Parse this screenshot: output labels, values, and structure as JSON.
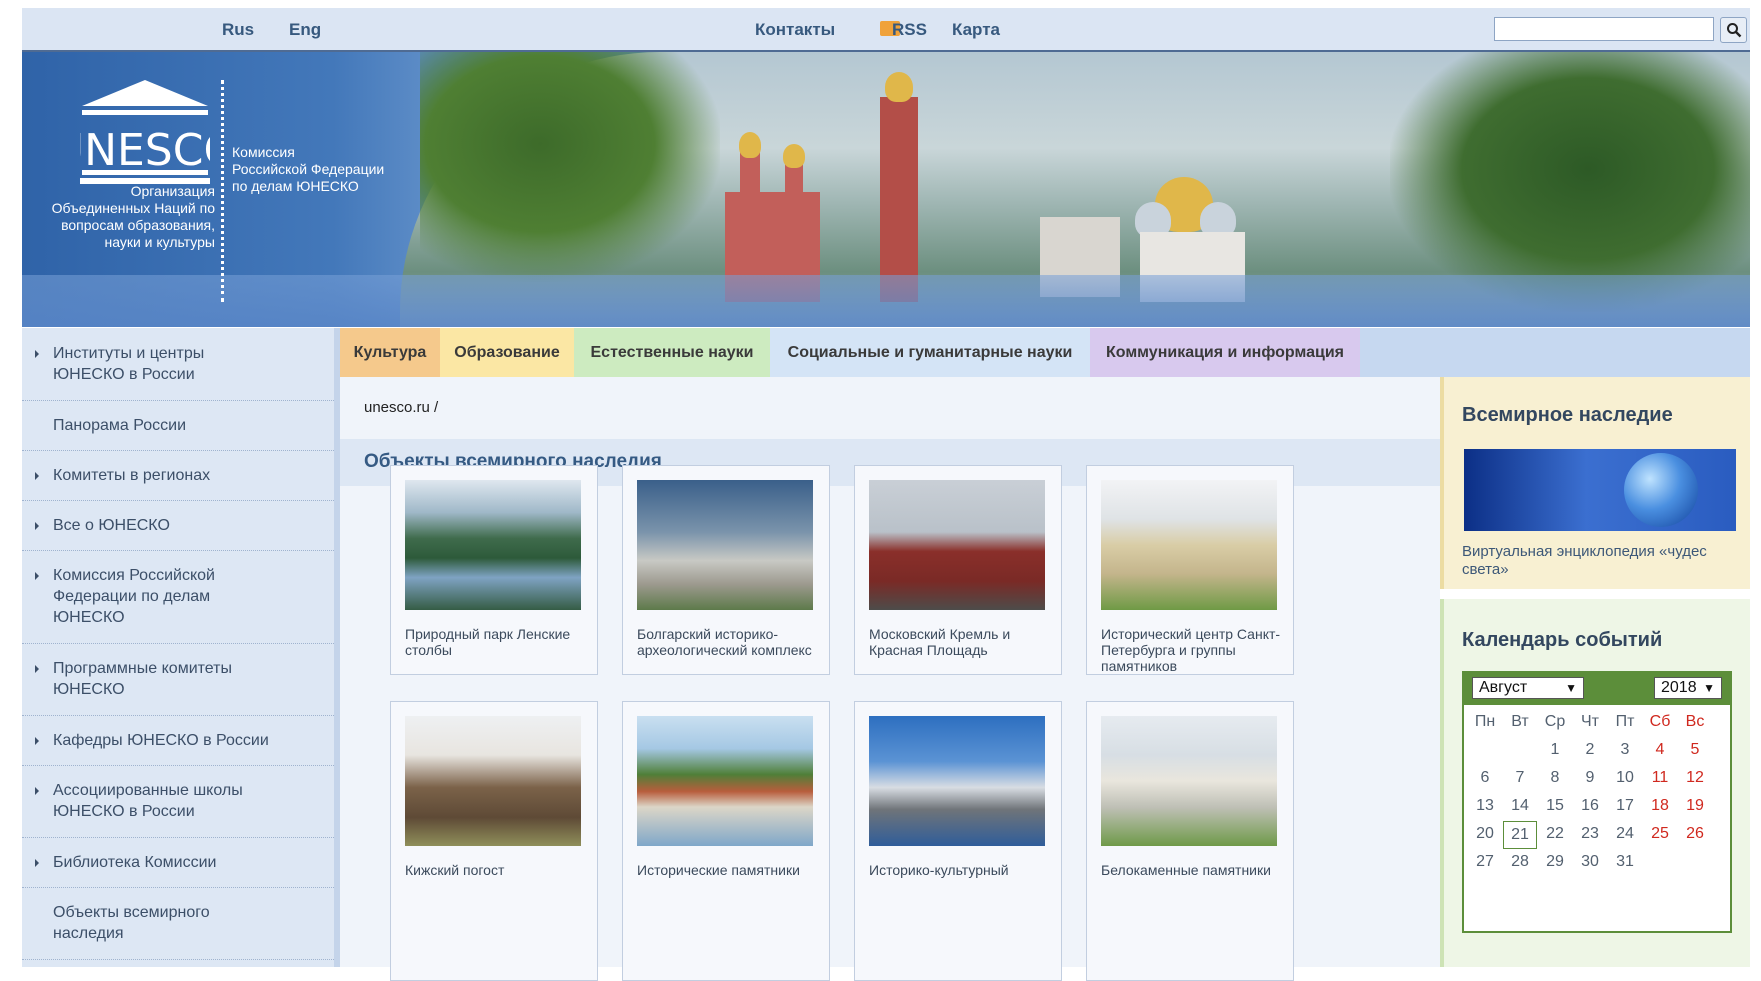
{
  "topbar": {
    "lang": [
      "Rus",
      "Eng"
    ],
    "contacts": "Контакты",
    "rss": "RSS",
    "map": "Карта",
    "search_value": ""
  },
  "banner": {
    "logo_text": "UNESCO",
    "commission": [
      "Комиссия",
      "Российской Федерации",
      "по делам ЮНЕСКО"
    ],
    "org": [
      "Организация",
      "Объединенных Наций по",
      "вопросам образования,",
      "науки и культуры"
    ]
  },
  "sidebar": {
    "items": [
      {
        "label": [
          "Институты и центры",
          "ЮНЕСКО в России"
        ],
        "bullet": true
      },
      {
        "label": [
          "Панорама России"
        ],
        "bullet": false
      },
      {
        "label": [
          "Комитеты в регионах"
        ],
        "bullet": true
      },
      {
        "label": [
          "Все о ЮНЕСКО"
        ],
        "bullet": true
      },
      {
        "label": [
          "Комиссия Российской",
          "Федерации по делам",
          "ЮНЕСКО"
        ],
        "bullet": true
      },
      {
        "label": [
          "Программные комитеты",
          "ЮНЕСКО"
        ],
        "bullet": true
      },
      {
        "label": [
          "Кафедры ЮНЕСКО в России"
        ],
        "bullet": true
      },
      {
        "label": [
          "Ассоциированные школы",
          "ЮНЕСКО в России"
        ],
        "bullet": true
      },
      {
        "label": [
          "Библиотека Комиссии"
        ],
        "bullet": true
      },
      {
        "label": [
          "Объекты всемирного",
          "наследия"
        ],
        "bullet": false
      }
    ]
  },
  "tabs": [
    {
      "label": "Культура",
      "color": "#f5c98c"
    },
    {
      "label": "Образование",
      "color": "#fbe7a4"
    },
    {
      "label": "Естественные науки",
      "color": "#cdebc0"
    },
    {
      "label": "Социальные и гуманитарные науки",
      "color": "#d4e4f6"
    },
    {
      "label": "Коммуникация и информация",
      "color": "#d8c9ee"
    }
  ],
  "main": {
    "breadcrumb": "unesco.ru /",
    "heading": "Объекты всемирного наследия",
    "cards": [
      {
        "caption": "Природный парк Ленские столбы",
        "thumb": "river-cliffs"
      },
      {
        "caption": "Болгарский историко-археологический комплекс",
        "thumb": "white-mosque"
      },
      {
        "caption": "Московский Кремль и Красная Площадь",
        "thumb": "kremlin"
      },
      {
        "caption": "Исторический центр Санкт-Петербурга и группы памятников",
        "thumb": "palace"
      },
      {
        "caption": "Кижский погост",
        "thumb": "wooden-church"
      },
      {
        "caption": "Исторические памятники",
        "thumb": "fortress-river"
      },
      {
        "caption": "Историко-культурный",
        "thumb": "monastery-sea"
      },
      {
        "caption": "Белокаменные памятники",
        "thumb": "white-cathedral"
      }
    ]
  },
  "right": {
    "heritage_title": "Всемирное наследие",
    "heritage_link": "Виртуальная энциклопедия «чудес света»",
    "calendar_title": "Календарь событий",
    "month": "Август",
    "year": "2018",
    "dow": [
      "Пн",
      "Вт",
      "Ср",
      "Чт",
      "Пт",
      "Сб",
      "Вс"
    ],
    "weeks": [
      [
        "",
        "",
        "1",
        "2",
        "3",
        "4",
        "5"
      ],
      [
        "6",
        "7",
        "8",
        "9",
        "10",
        "11",
        "12"
      ],
      [
        "13",
        "14",
        "15",
        "16",
        "17",
        "18",
        "19"
      ],
      [
        "20",
        "21",
        "22",
        "23",
        "24",
        "25",
        "26"
      ],
      [
        "27",
        "28",
        "29",
        "30",
        "31",
        "",
        ""
      ]
    ],
    "today": "21"
  }
}
